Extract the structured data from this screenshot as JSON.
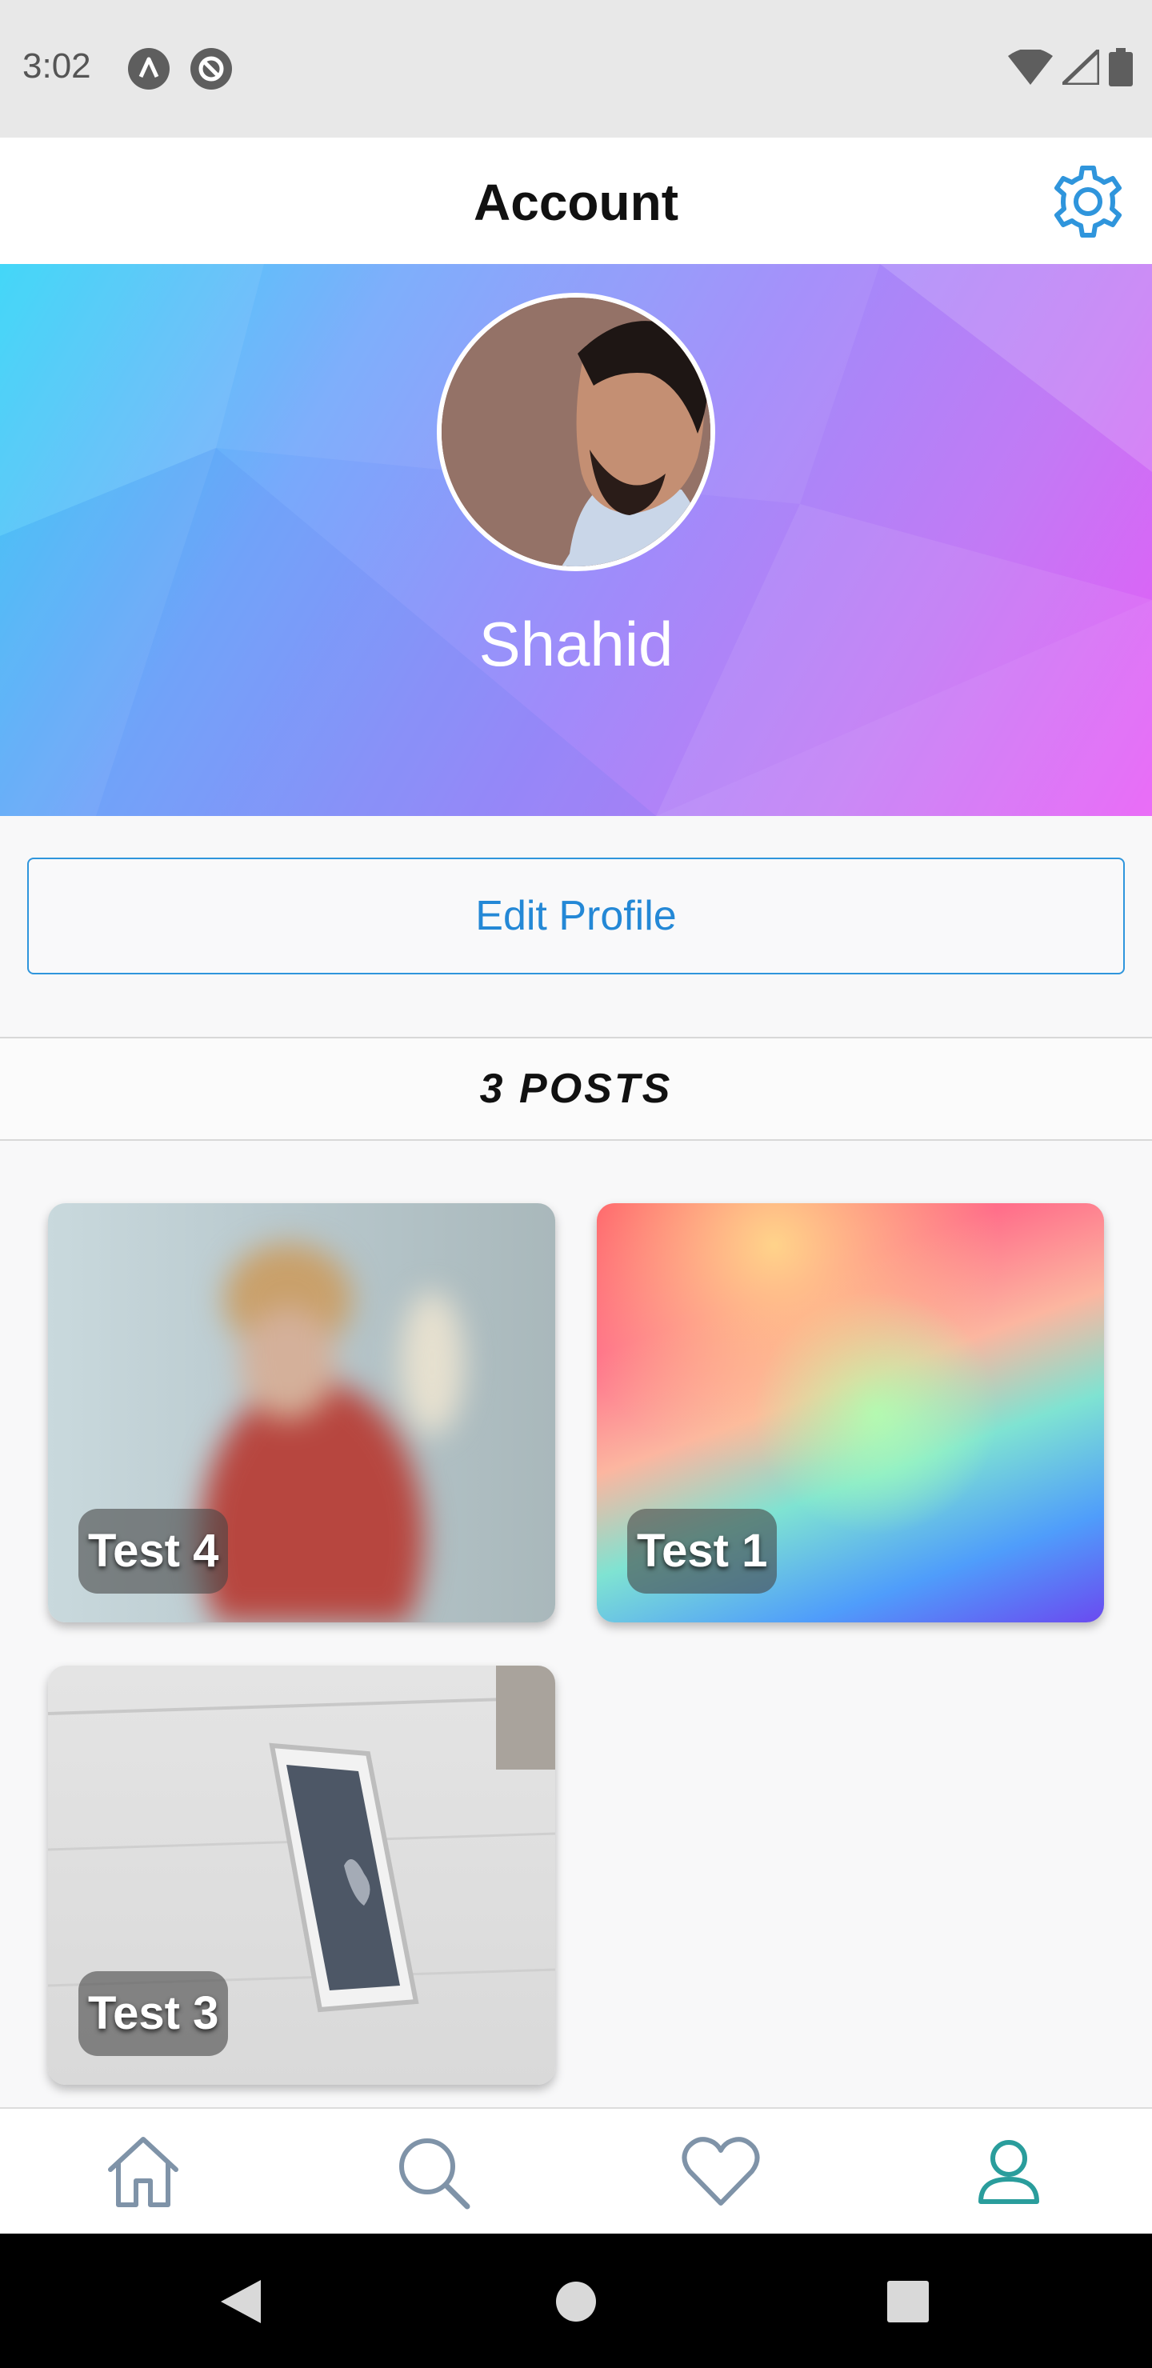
{
  "status_bar": {
    "time": "3:02",
    "left_icons": [
      "android-a-icon",
      "no-entry-icon"
    ],
    "right_icons": [
      "wifi-icon",
      "signal-icon",
      "battery-icon"
    ]
  },
  "header": {
    "title": "Account",
    "settings_icon": "gear-icon",
    "accent_color": "#2f95dc"
  },
  "profile": {
    "name": "Shahid",
    "avatar_icon": "user-photo"
  },
  "edit_profile_label": "Edit Profile",
  "posts": {
    "count_label": "3 POSTS",
    "items": [
      {
        "label": "Test 4"
      },
      {
        "label": "Test 1"
      },
      {
        "label": "Test 3"
      }
    ]
  },
  "bottom_nav": {
    "items": [
      {
        "icon": "home-icon",
        "active": false
      },
      {
        "icon": "search-icon",
        "active": false
      },
      {
        "icon": "heart-icon",
        "active": false
      },
      {
        "icon": "profile-icon",
        "active": true
      }
    ],
    "active_color": "#2a9d9c",
    "inactive_color": "#7f93a8"
  },
  "system_nav": {
    "icons": [
      "back-icon",
      "home-circle-icon",
      "recents-icon"
    ]
  }
}
